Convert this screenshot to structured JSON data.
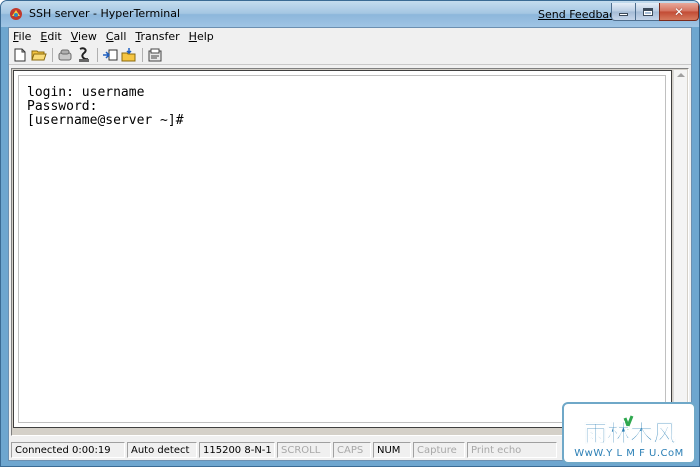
{
  "window": {
    "title": "SSH server - HyperTerminal",
    "send_feedback": "Send Feedback",
    "close_glyph": "✕"
  },
  "menu": [
    {
      "accel": "F",
      "rest": "ile"
    },
    {
      "accel": "E",
      "rest": "dit"
    },
    {
      "accel": "V",
      "rest": "iew"
    },
    {
      "accel": "C",
      "rest": "all"
    },
    {
      "accel": "T",
      "rest": "ransfer"
    },
    {
      "accel": "H",
      "rest": "elp"
    }
  ],
  "toolbar": {
    "icons": [
      "new-document-icon",
      "open-folder-icon",
      "disconnect-phone-icon",
      "connect-phone-icon",
      "send-file-icon",
      "receive-file-icon",
      "properties-icon"
    ]
  },
  "terminal": {
    "lines": [
      "login: username",
      "Password:",
      "[username@server ~]#"
    ]
  },
  "status": {
    "panes": [
      {
        "text": "Connected 0:00:19",
        "enabled": true
      },
      {
        "text": "Auto detect",
        "enabled": true
      },
      {
        "text": "115200 8-N-1",
        "enabled": true
      },
      {
        "text": "SCROLL",
        "enabled": false
      },
      {
        "text": "CAPS",
        "enabled": false
      },
      {
        "text": "NUM",
        "enabled": true
      },
      {
        "text": "Capture",
        "enabled": false
      },
      {
        "text": "Print echo",
        "enabled": false
      }
    ]
  },
  "watermark": {
    "logo_text": "雨林木风",
    "url": "WwW.Y L M F U.CoM"
  },
  "colors": {
    "titlebar": "#a4c6e2",
    "close_button": "#c24a34",
    "watermark_blue": "#2b7fb5",
    "watermark_green": "#2fa84f"
  }
}
